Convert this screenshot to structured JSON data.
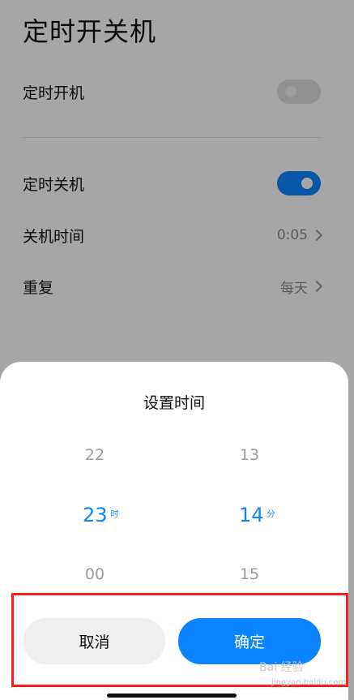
{
  "header": {
    "title": "定时开关机"
  },
  "settings": {
    "power_on": {
      "label": "定时开机",
      "enabled": false
    },
    "power_off": {
      "label": "定时关机",
      "enabled": true
    },
    "off_time": {
      "label": "关机时间",
      "value": "0:05"
    },
    "repeat": {
      "label": "重复",
      "value": "每天"
    }
  },
  "dialog": {
    "title": "设置时间",
    "hour": {
      "prev": "22",
      "selected": "23",
      "next": "00",
      "unit": "时"
    },
    "minute": {
      "prev": "13",
      "selected": "14",
      "next": "15",
      "unit": "分"
    },
    "cancel_label": "取消",
    "confirm_label": "确定"
  },
  "watermark": {
    "text": "Bai 经验",
    "sub": "jingyan.baidu.com"
  },
  "colors": {
    "accent": "#0d84ff",
    "highlight_box": "#ff1d1d"
  }
}
